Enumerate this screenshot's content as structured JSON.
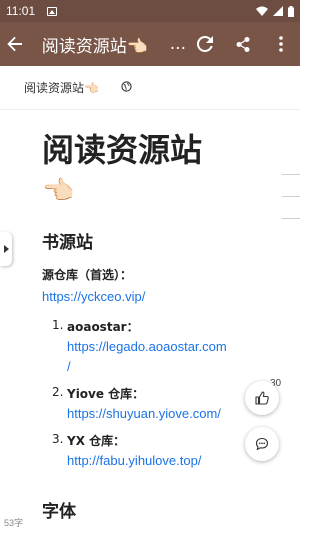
{
  "status_bar": {
    "time": "11:01"
  },
  "app_bar": {
    "title": "阅读资源站👈🏻",
    "title_ellipsis": "..."
  },
  "tab": {
    "title": "阅读资源站👈🏻"
  },
  "article": {
    "heading": "阅读资源站",
    "heading_emoji": "👈🏻",
    "section1": "书源站",
    "repo_label": "源仓库（首选）：",
    "repo_link": "https://yckceo.vip/",
    "items": [
      {
        "num": "1.",
        "label": "aoaostar：",
        "link_line1": "https://legado.aoaostar.com",
        "link_line2": "/"
      },
      {
        "num": "2.",
        "label": "Yiove 仓库：",
        "link_line1": "https://shuyuan.yiove.com/"
      },
      {
        "num": "3.",
        "label": "YX 仓库：",
        "link_line1": "http://fabu.yihulove.top/"
      }
    ],
    "section2": "字体"
  },
  "fab": {
    "like_count": "30"
  },
  "footer": {
    "word_count": "53字"
  },
  "colors": {
    "app_bar": "#795548",
    "status_bar": "#6d4c41",
    "link": "#1a73e8"
  }
}
